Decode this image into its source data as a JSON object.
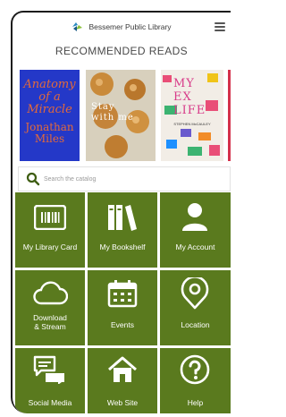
{
  "header": {
    "library_name": "Bessemer Public Library"
  },
  "recommended": {
    "title": "RECOMMENDED READS",
    "books": [
      {
        "title_lines": [
          "Anatomy",
          "of a",
          "Miracle"
        ],
        "author_lines": [
          "Jonathan",
          "Miles"
        ]
      },
      {
        "title_lines": [
          "Stay",
          "with me"
        ]
      },
      {
        "title_lines": [
          "MY",
          "EX",
          "LIFE"
        ],
        "author_lines": [
          "STEPHEN McCAULEY"
        ]
      },
      {
        "title_lines": []
      }
    ]
  },
  "search": {
    "placeholder": "Search the catalog"
  },
  "tiles": [
    {
      "label": "My Library Card",
      "icon": "library-card-icon"
    },
    {
      "label": "My Bookshelf",
      "icon": "bookshelf-icon"
    },
    {
      "label": "My Account",
      "icon": "account-icon"
    },
    {
      "label": "Download & Stream",
      "icon": "cloud-icon"
    },
    {
      "label": "Events",
      "icon": "calendar-icon"
    },
    {
      "label": "Location",
      "icon": "location-pin-icon"
    },
    {
      "label": "Social Media",
      "icon": "chat-icon"
    },
    {
      "label": "Web Site",
      "icon": "home-icon"
    },
    {
      "label": "Help",
      "icon": "help-icon"
    }
  ],
  "colors": {
    "tile_green": "#5a7a1e",
    "header_text": "#4a4a4a"
  }
}
